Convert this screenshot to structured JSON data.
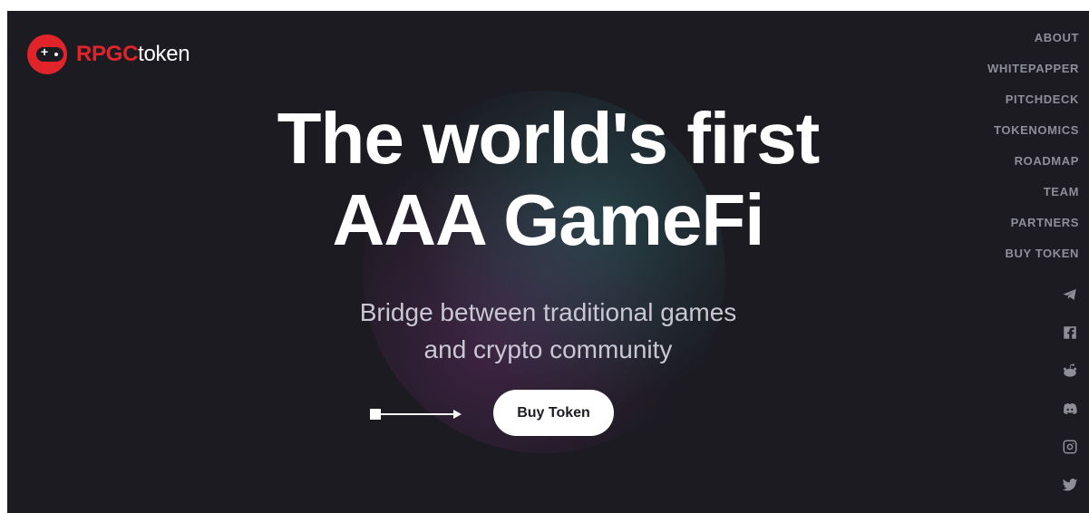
{
  "logo": {
    "brand": "RPGC",
    "suffix": "token"
  },
  "nav": [
    "ABOUT",
    "WHITEPAPPER",
    "PITCHDECK",
    "TOKENOMICS",
    "ROADMAP",
    "TEAM",
    "PARTNERS",
    "BUY TOKEN"
  ],
  "socials": [
    "telegram-icon",
    "facebook-icon",
    "reddit-icon",
    "discord-icon",
    "instagram-icon",
    "twitter-icon"
  ],
  "hero": {
    "title_line1": "The world's first",
    "title_line2": "AAA GameFi",
    "subtitle_line1": "Bridge between traditional games",
    "subtitle_line2": "and crypto community",
    "cta": "Buy Token"
  },
  "colors": {
    "background": "#1c1b22",
    "brand_red": "#e0242a",
    "nav_text": "#8e8e96"
  }
}
